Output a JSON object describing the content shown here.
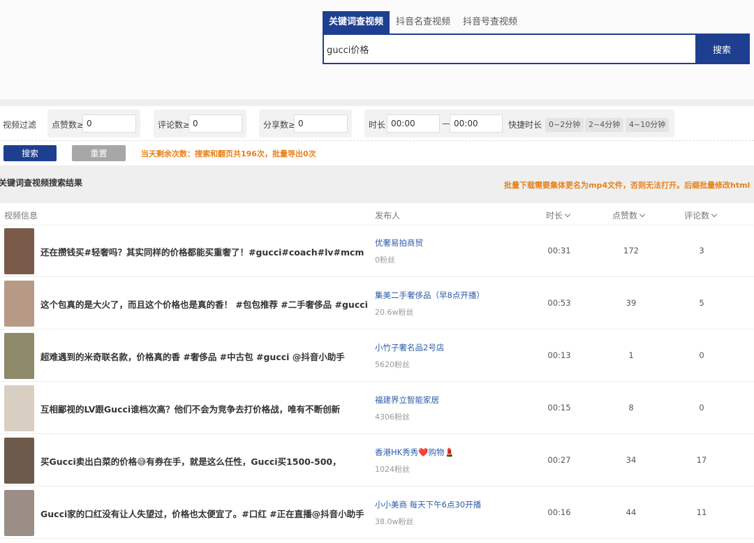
{
  "tabs": [
    {
      "label": "关键词查视频",
      "active": true
    },
    {
      "label": "抖音名查视频",
      "active": false
    },
    {
      "label": "抖音号查视频",
      "active": false
    }
  ],
  "search": {
    "value": "gucci价格",
    "button": "搜索"
  },
  "filter": {
    "label": "视频过滤",
    "likes_label": "点赞数≥",
    "likes_value": "0",
    "comments_label": "评论数≥",
    "comments_value": "0",
    "shares_label": "分享数≥",
    "shares_value": "0",
    "duration_label": "时长",
    "duration_from": "00:00",
    "duration_sep": "—",
    "duration_to": "00:00",
    "quick_label": "快捷时长",
    "quick": [
      "0~2分钟",
      "2~4分钟",
      "4~10分钟"
    ]
  },
  "actions": {
    "search": "搜索",
    "reset": "重置",
    "remaining": "当天剩余次数：搜索和翻页共196次，批量导出0次"
  },
  "results": {
    "title": "关键词查视频搜索结果",
    "note": "批量下载需要集体更名为mp4文件，否则无法打开。后缀批量修改html"
  },
  "columns": {
    "video": "视频信息",
    "publisher": "发布人",
    "duration": "时长",
    "likes": "点赞数",
    "comments": "评论数"
  },
  "rows": [
    {
      "title": "还在攒钱买#轻奢吗？其实同样的价格都能买重奢了！#gucci#coach#lv#mcm",
      "publisher": "优奢易拍商贸",
      "fans": "0粉丝",
      "duration": "00:31",
      "likes": "172",
      "comments": "3"
    },
    {
      "title": "这个包真的是大火了，而且这个价格也是真的香！ #包包推荐 #二手奢侈品 #gucci",
      "publisher": "集美二手奢侈品（早8点开播）",
      "fans": "20.6w粉丝",
      "duration": "00:53",
      "likes": "39",
      "comments": "5"
    },
    {
      "title": "超难遇到的米奇联名款，价格真的香 #奢侈品 #中古包 #gucci @抖音小助手",
      "publisher": "小竹子奢名品2号店",
      "fans": "5620粉丝",
      "duration": "00:13",
      "likes": "1",
      "comments": "0"
    },
    {
      "title": "互相鄙视的LV跟Gucci谁档次高？他们不会为竞争去打价格战，唯有不断创新",
      "publisher": "福建界立智能家居",
      "fans": "4306粉丝",
      "duration": "00:15",
      "likes": "8",
      "comments": "0"
    },
    {
      "title": "买Gucci卖出白菜的价格😅有券在手，就是这么任性，Gucci买1500-500，",
      "publisher": "香港HK秀秀❤️购物💄",
      "fans": "1024粉丝",
      "duration": "00:27",
      "likes": "34",
      "comments": "17"
    },
    {
      "title": "Gucci家的口红没有让人失望过，价格也太便宜了。#口红 #正在直播@抖音小助手",
      "publisher": "小小美商 每天下午6点30开播",
      "fans": "38.0w粉丝",
      "duration": "00:16",
      "likes": "44",
      "comments": "11"
    }
  ],
  "thumb_colors": [
    "#7a5a48",
    "#b79a86",
    "#8e8a6a",
    "#d8cfc2",
    "#6e5a4a",
    "#9a8e86"
  ]
}
